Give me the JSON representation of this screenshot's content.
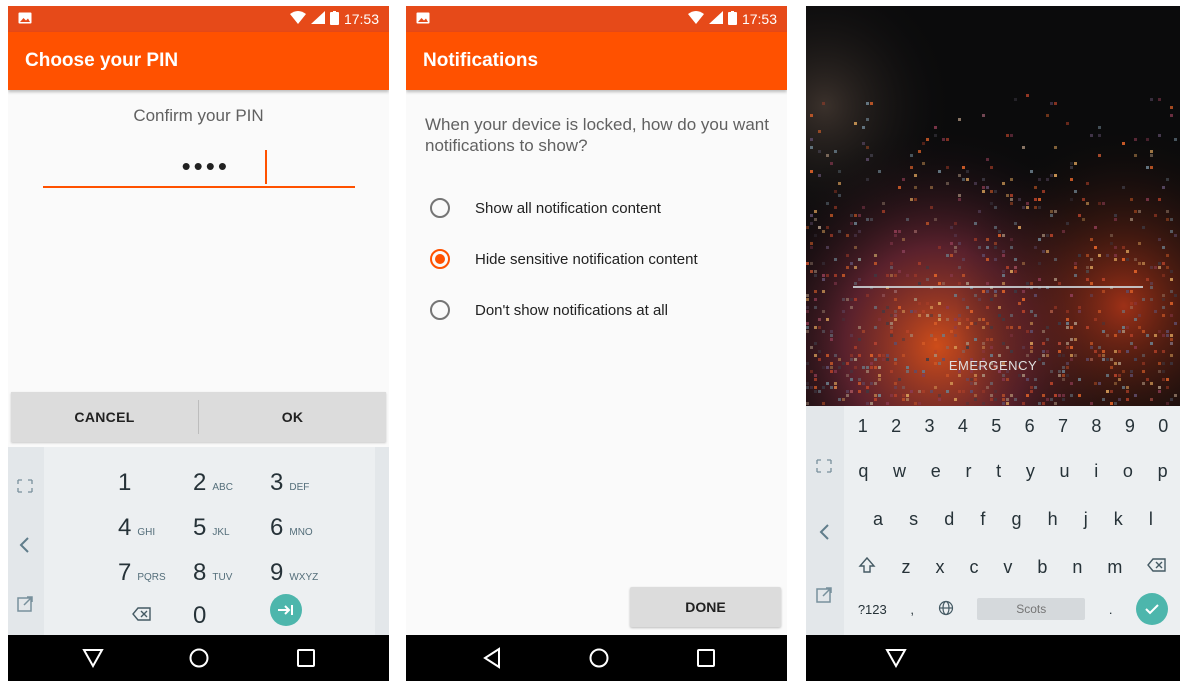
{
  "status": {
    "time": "17:53"
  },
  "pin_screen": {
    "title": "Choose your PIN",
    "prompt": "Confirm your PIN",
    "dots": "••••",
    "cancel": "CANCEL",
    "ok": "OK",
    "keys": [
      {
        "d": "1",
        "l": ""
      },
      {
        "d": "2",
        "l": "ABC"
      },
      {
        "d": "3",
        "l": "DEF"
      },
      {
        "d": "4",
        "l": "GHI"
      },
      {
        "d": "5",
        "l": "JKL"
      },
      {
        "d": "6",
        "l": "MNO"
      },
      {
        "d": "7",
        "l": "PQRS"
      },
      {
        "d": "8",
        "l": "TUV"
      },
      {
        "d": "9",
        "l": "WXYZ"
      },
      {
        "d": "0",
        "l": ""
      }
    ]
  },
  "notifications_screen": {
    "title": "Notifications",
    "question": "When your device is locked, how do you want notifications to show?",
    "options": [
      {
        "label": "Show all notification content",
        "selected": false
      },
      {
        "label": "Hide sensitive notification content",
        "selected": true
      },
      {
        "label": "Don't show notifications at all",
        "selected": false
      }
    ],
    "done": "DONE"
  },
  "lock_screen": {
    "emergency": "EMERGENCY",
    "keyboard": {
      "numbers": [
        "1",
        "2",
        "3",
        "4",
        "5",
        "6",
        "7",
        "8",
        "9",
        "0"
      ],
      "row1": [
        "q",
        "w",
        "e",
        "r",
        "t",
        "y",
        "u",
        "i",
        "o",
        "p"
      ],
      "row2": [
        "a",
        "s",
        "d",
        "f",
        "g",
        "h",
        "j",
        "k",
        "l"
      ],
      "row3": [
        "z",
        "x",
        "c",
        "v",
        "b",
        "n",
        "m"
      ],
      "symbols_key": "?123",
      "comma": ",",
      "period": ".",
      "space_label": "Scots"
    }
  },
  "colors": {
    "accent": "#ff5100",
    "status_bar": "#e64a19",
    "teal": "#4db6ac"
  }
}
